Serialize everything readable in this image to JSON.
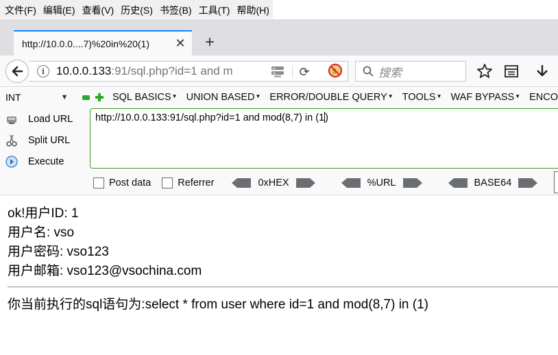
{
  "menubar": {
    "items": [
      "文件(F)",
      "编辑(E)",
      "查看(V)",
      "历史(S)",
      "书签(B)",
      "工具(T)",
      "帮助(H)"
    ]
  },
  "tabs": [
    {
      "title": "http://10.0.0....7)%20in%20(1)",
      "close_icon": "close-icon"
    }
  ],
  "new_tab_label": "+",
  "urlbar": {
    "host": "10.0.0.133",
    "rest": ":91/sql.php?id=1 and m"
  },
  "search": {
    "placeholder": "搜索"
  },
  "hackbar": {
    "select_value": "INT",
    "menus": [
      "SQL BASICS",
      "UNION BASED",
      "ERROR/DOUBLE QUERY",
      "TOOLS",
      "WAF BYPASS",
      "ENCO"
    ],
    "side": [
      {
        "label": "Load URL",
        "icon": "load-url-icon"
      },
      {
        "label": "Split URL",
        "icon": "split-url-icon"
      },
      {
        "label": "Execute",
        "icon": "execute-icon"
      }
    ],
    "url_value": "http://10.0.0.133:91/sql.php?id=1 and mod(8,7) in (1",
    "url_value_tail": ")",
    "options": {
      "post_data": "Post data",
      "referrer": "Referrer",
      "enc_hex": "0xHEX",
      "enc_url": "%URL",
      "enc_base64": "BASE64"
    }
  },
  "page": {
    "lines": [
      "ok!用户ID: 1",
      "用户名: vso",
      "用户密码: vso123",
      "用户邮箱: vso123@vsochina.com"
    ],
    "sql_statement": "你当前执行的sql语句为:select * from user where id=1 and mod(8,7) in (1)"
  },
  "colors": {
    "tab_accent": "#0a84ff",
    "hackbar_border": "#3a9d23",
    "chrome_bg": "#f9f9fa",
    "tabstrip_bg": "#dfdfe3"
  }
}
